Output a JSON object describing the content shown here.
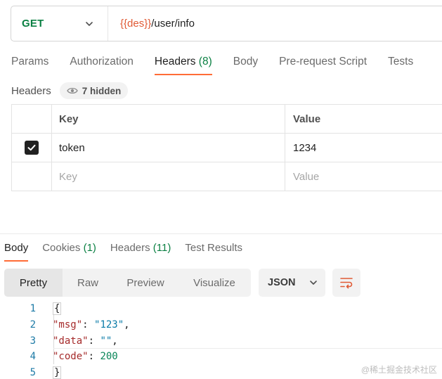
{
  "request": {
    "method": "GET",
    "url_var": "{{des}}",
    "url_path": "/user/info"
  },
  "request_tabs": [
    {
      "label": "Params"
    },
    {
      "label": "Authorization"
    },
    {
      "label": "Headers",
      "count": "(8)",
      "active": true
    },
    {
      "label": "Body"
    },
    {
      "label": "Pre-request Script"
    },
    {
      "label": "Tests"
    }
  ],
  "headers_section": {
    "title": "Headers",
    "hidden_label": "7 hidden",
    "columns": {
      "key": "Key",
      "value": "Value"
    },
    "rows": [
      {
        "checked": true,
        "key": "token",
        "value": "1234"
      }
    ],
    "placeholder": {
      "key": "Key",
      "value": "Value"
    }
  },
  "response_tabs": [
    {
      "label": "Body",
      "active": true
    },
    {
      "label": "Cookies",
      "count": "(1)"
    },
    {
      "label": "Headers",
      "count": "(11)"
    },
    {
      "label": "Test Results"
    }
  ],
  "view_modes": [
    "Pretty",
    "Raw",
    "Preview",
    "Visualize"
  ],
  "active_view": "Pretty",
  "language": "JSON",
  "code_lines": [
    {
      "n": "1"
    },
    {
      "n": "2"
    },
    {
      "n": "3"
    },
    {
      "n": "4"
    },
    {
      "n": "5"
    }
  ],
  "json": {
    "open": "{",
    "close": "}",
    "msg_key": "\"msg\"",
    "msg_val": "\"123\"",
    "data_key": "\"data\"",
    "data_val": "\"\"",
    "code_key": "\"code\"",
    "code_val": "200"
  },
  "watermark": "@稀土掘金技术社区",
  "colors": {
    "accent": "#ff6c37",
    "method_green": "#0b8043",
    "url_variable": "#e05a35"
  }
}
